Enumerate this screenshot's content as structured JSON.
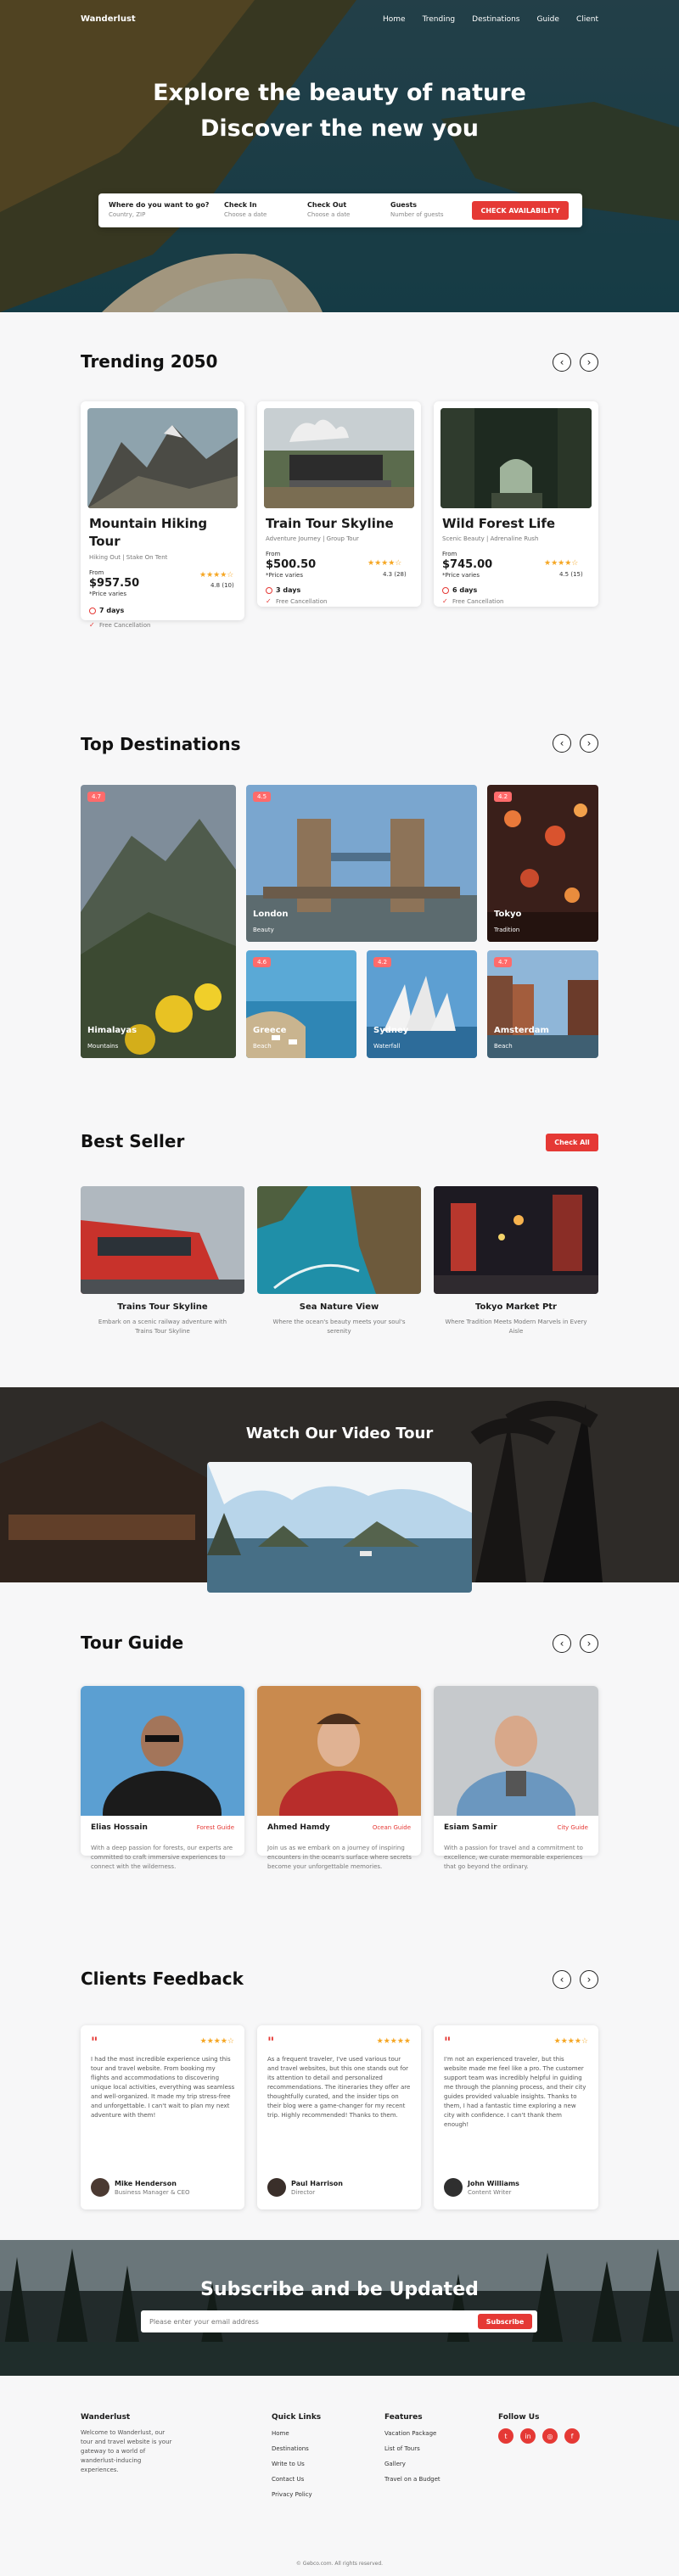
{
  "nav": {
    "logo": "Wanderlust",
    "items": [
      "Home",
      "Trending",
      "Destinations",
      "Guide",
      "Client"
    ]
  },
  "hero": {
    "line1": "Explore the beauty of nature",
    "line2": "Discover the new you",
    "search": {
      "where_label": "Where do you want to go?",
      "where_placeholder": "Country, ZIP",
      "checkin_label": "Check In",
      "checkin_placeholder": "Choose a date",
      "checkout_label": "Check Out",
      "checkout_placeholder": "Choose a date",
      "guests_label": "Guests",
      "guests_placeholder": "Number of guests",
      "button": "CHECK AVAILABILITY"
    }
  },
  "trending": {
    "title": "Trending 2050",
    "cards": [
      {
        "name": "Mountain Hiking Tour",
        "tags": "Hiking Out | Stake On Tent",
        "from": "From",
        "price": "$957.50",
        "note": "*Price varies",
        "rating": "4.8 (10)",
        "days": "7 days",
        "cancel": "Free Cancellation",
        "stars": 4
      },
      {
        "name": "Train Tour Skyline",
        "tags": "Adventure Journey | Group Tour",
        "from": "From",
        "price": "$500.50",
        "note": "*Price varies",
        "rating": "4.3 (28)",
        "days": "3 days",
        "cancel": "Free Cancellation",
        "stars": 4
      },
      {
        "name": "Wild Forest Life",
        "tags": "Scenic Beauty | Adrenaline Rush",
        "from": "From",
        "price": "$745.00",
        "note": "*Price varies",
        "rating": "4.5 (15)",
        "days": "6 days",
        "cancel": "Free Cancellation",
        "stars": 4
      }
    ]
  },
  "destinations": {
    "title": "Top Destinations",
    "items": [
      {
        "name": "Himalayas",
        "sub": "Mountains",
        "rating": "4.7"
      },
      {
        "name": "London",
        "sub": "Beauty",
        "rating": "4.5"
      },
      {
        "name": "Tokyo",
        "sub": "Tradition",
        "rating": "4.2"
      },
      {
        "name": "Greece",
        "sub": "Beach",
        "rating": "4.6"
      },
      {
        "name": "Sydney",
        "sub": "Waterfall",
        "rating": "4.2"
      },
      {
        "name": "Amsterdam",
        "sub": "Beach",
        "rating": "4.7"
      }
    ]
  },
  "bestseller": {
    "title": "Best Seller",
    "button": "Check All",
    "items": [
      {
        "name": "Trains Tour Skyline",
        "desc": "Embark on a scenic railway adventure with Trains Tour Skyline"
      },
      {
        "name": "Sea Nature View",
        "desc": "Where the ocean's beauty meets your soul's serenity"
      },
      {
        "name": "Tokyo Market Ptr",
        "desc": "Where Tradition Meets Modern Marvels in Every Aisle"
      }
    ]
  },
  "video": {
    "title": "Watch Our Video Tour"
  },
  "guides": {
    "title": "Tour Guide",
    "items": [
      {
        "name": "Elias Hossain",
        "role": "Forest Guide",
        "desc": "With a deep passion for forests, our experts are committed to craft immersive experiences to connect with the wilderness."
      },
      {
        "name": "Ahmed Hamdy",
        "role": "Ocean Guide",
        "desc": "Join us as we embark on a journey of inspiring encounters in the ocean's surface where secrets become your unforgettable memories."
      },
      {
        "name": "Esiam Samir",
        "role": "City Guide",
        "desc": "With a passion for travel and a commitment to excellence, we curate memorable experiences that go beyond the ordinary."
      }
    ]
  },
  "feedback": {
    "title": "Clients Feedback",
    "items": [
      {
        "text": "I had the most incredible experience using this tour and travel website. From booking my flights and accommodations to discovering unique local activities, everything was seamless and well-organized. It made my trip stress-free and unforgettable. I can't wait to plan my next adventure with them!",
        "name": "Mike Henderson",
        "role": "Business Manager & CEO",
        "stars": 4
      },
      {
        "text": "As a frequent traveler, I've used various tour and travel websites, but this one stands out for its attention to detail and personalized recommendations. The itineraries they offer are thoughtfully curated, and the insider tips on their blog were a game-changer for my recent trip. Highly recommended! Thanks to them.",
        "name": "Paul Harrison",
        "role": "Director",
        "stars": 5
      },
      {
        "text": "I'm not an experienced traveler, but this website made me feel like a pro. The customer support team was incredibly helpful in guiding me through the planning process, and their city guides provided valuable insights. Thanks to them, I had a fantastic time exploring a new city with confidence. I can't thank them enough!",
        "name": "John Williams",
        "role": "Content Writer",
        "stars": 4
      }
    ]
  },
  "subscribe": {
    "title": "Subscribe and be Updated",
    "placeholder": "Please enter your email address",
    "button": "Subscribe"
  },
  "footer": {
    "brand": "Wanderlust",
    "about": "Welcome to Wanderlust, our tour and travel website is your gateway to a world of wanderlust-inducing experiences.",
    "quick_title": "Quick Links",
    "quick": [
      "Home",
      "Destinations",
      "Write to Us",
      "Contact Us",
      "Privacy Policy"
    ],
    "features_title": "Features",
    "features": [
      "Vacation Package",
      "List of Tours",
      "Gallery",
      "Travel on a Budget"
    ],
    "follow_title": "Follow Us",
    "copyright": "© Gebco.com. All rights reserved."
  },
  "colors": {
    "accent": "#e53935",
    "star": "#f5a623"
  }
}
